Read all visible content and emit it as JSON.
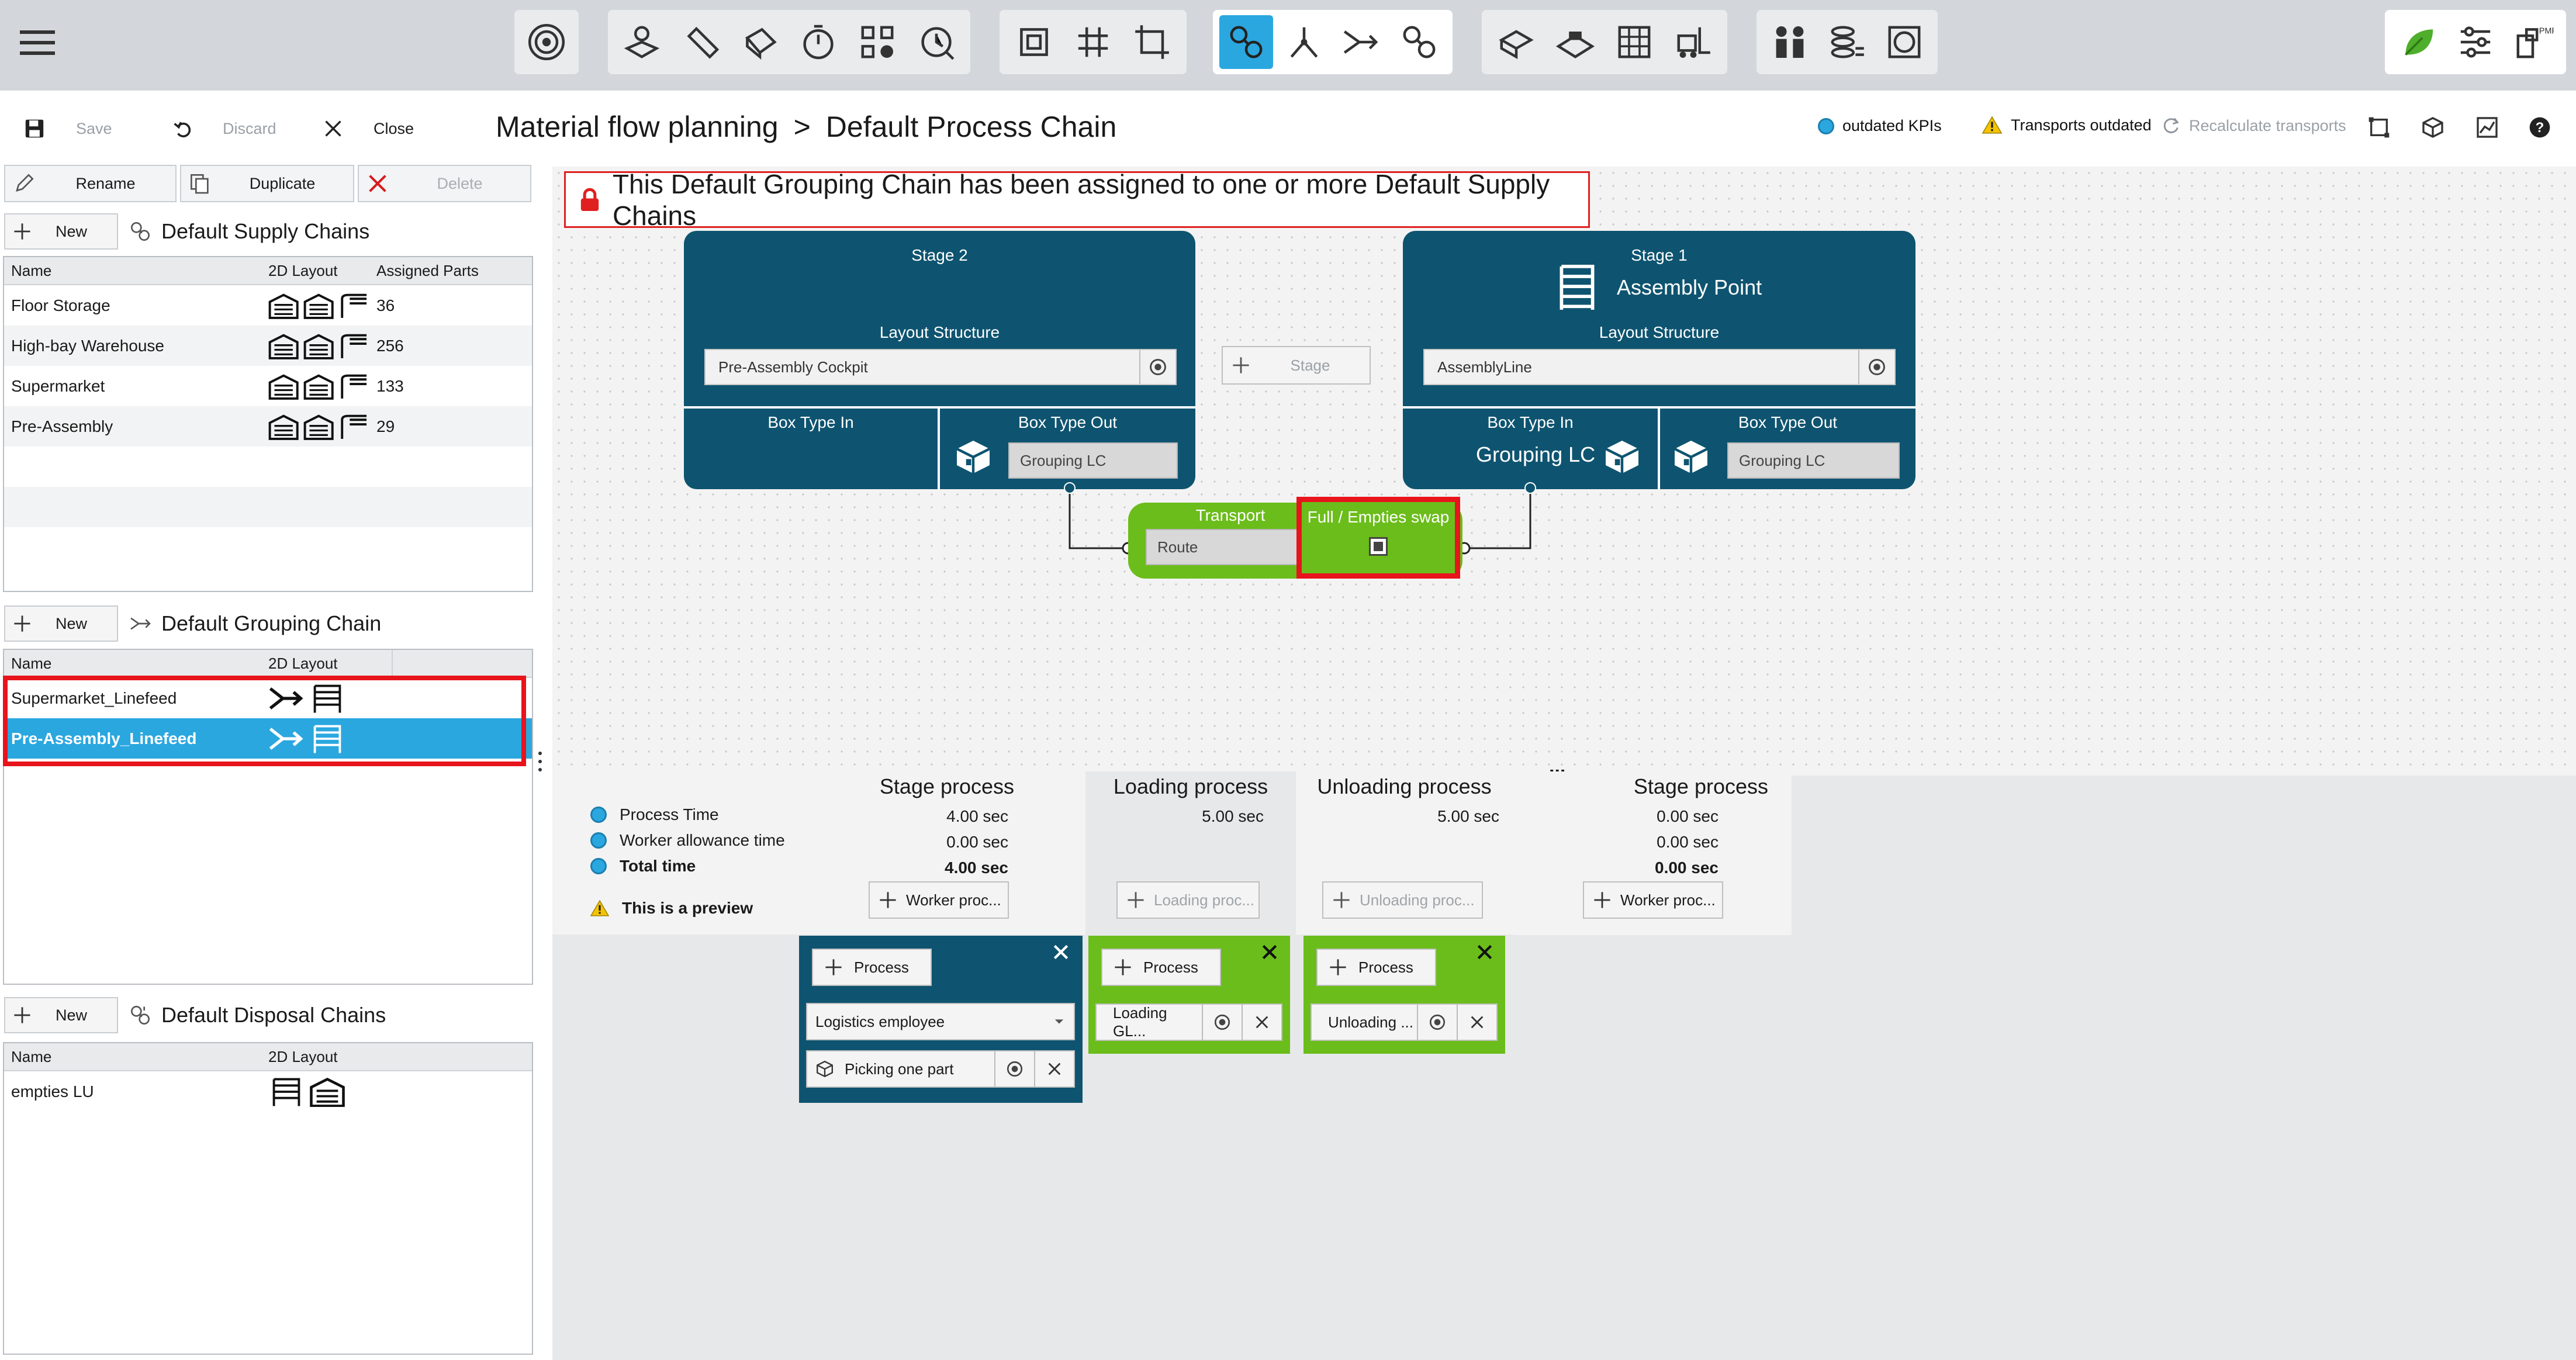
{
  "colors": {
    "accent": "#2aa7df",
    "stage_bg": "#0e5470",
    "green": "#6bbd1b",
    "highlight": "#e02020"
  },
  "toolbar": {
    "groups": [
      [
        "target-icon"
      ],
      [
        "box-edit-icon",
        "ruler-icon",
        "box-tilt-icon",
        "timer-icon",
        "grid-gear-icon",
        "time-cycle-icon"
      ],
      [
        "layout-frame-icon",
        "grid-icon",
        "crop-icon"
      ],
      [
        "link-chain-icon",
        "branch-icon",
        "merge-arrow-icon",
        "link-chain-alt-icon"
      ],
      [
        "forklift-box-icon",
        "conveyor-icon",
        "shelf-icon",
        "forklift-icon"
      ],
      [
        "people-icon",
        "stack-coins-icon",
        "gauge-icon"
      ],
      [
        "leaf-icon",
        "sliders-icon",
        "pmf-icon"
      ]
    ],
    "active": "link-chain-icon"
  },
  "actions": {
    "save": "Save",
    "discard": "Discard",
    "close": "Close"
  },
  "breadcrumb": {
    "root": "Material flow planning",
    "sep": ">",
    "page": "Default Process Chain"
  },
  "status": {
    "kpis": "outdated KPIs",
    "transports": "Transports outdated",
    "recalc": "Recalculate transports"
  },
  "left": {
    "rename": "Rename",
    "duplicate": "Duplicate",
    "delete": "Delete",
    "new": "New",
    "supply": {
      "title": "Default Supply Chains",
      "headers": [
        "Name",
        "2D Layout",
        "Assigned Parts"
      ],
      "rows": [
        {
          "name": "Floor Storage",
          "parts": "36"
        },
        {
          "name": "High-bay Warehouse",
          "parts": "256"
        },
        {
          "name": "Supermarket",
          "parts": "133"
        },
        {
          "name": "Pre-Assembly",
          "parts": "29"
        }
      ]
    },
    "grouping": {
      "title": "Default Grouping Chain",
      "headers": [
        "Name",
        "2D Layout"
      ],
      "rows": [
        {
          "name": "Supermarket_Linefeed"
        },
        {
          "name": "Pre-Assembly_Linefeed"
        }
      ],
      "selected": 1
    },
    "disposal": {
      "title": "Default Disposal Chains",
      "headers": [
        "Name",
        "2D Layout"
      ],
      "rows": [
        {
          "name": "empties LU"
        }
      ]
    }
  },
  "banner": "This Default Grouping Chain has been assigned to one or more Default Supply Chains",
  "stage2": {
    "title": "Stage 2",
    "layout_label": "Layout Structure",
    "layout_value": "Pre-Assembly Cockpit",
    "box_in": "Box Type In",
    "box_out": "Box Type Out",
    "box_out_value": "Grouping LC"
  },
  "stage1": {
    "title": "Stage 1",
    "name": "Assembly Point",
    "layout_label": "Layout Structure",
    "layout_value": "AssemblyLine",
    "box_in": "Box Type In",
    "box_in_value": "Grouping LC",
    "box_out": "Box Type Out",
    "box_out_value": "Grouping LC"
  },
  "add_stage": "Stage",
  "transport": {
    "label": "Transport",
    "route": "Route",
    "swap": "Full / Empties swap"
  },
  "process": {
    "metrics": [
      "Process Time",
      "Worker allowance time",
      "Total time"
    ],
    "preview": "This is a preview",
    "columns": [
      {
        "title": "Stage process",
        "values": [
          "4.00 sec",
          "0.00 sec",
          "4.00 sec"
        ],
        "button": "Worker proc..."
      },
      {
        "title": "Loading process",
        "values": [
          "5.00 sec"
        ],
        "button": "Loading proc..."
      },
      {
        "title": "Unloading process",
        "values": [
          "5.00 sec"
        ],
        "button": "Unloading proc..."
      },
      {
        "title": "Stage process",
        "values": [
          "0.00 sec",
          "0.00 sec",
          "0.00 sec"
        ],
        "button": "Worker proc..."
      }
    ],
    "more": "...",
    "card1": {
      "button": "Process",
      "select": "Logistics employee",
      "item": "Picking one part"
    },
    "card2": {
      "button": "Process",
      "item": "Loading GL..."
    },
    "card3": {
      "button": "Process",
      "item": "Unloading ..."
    }
  }
}
